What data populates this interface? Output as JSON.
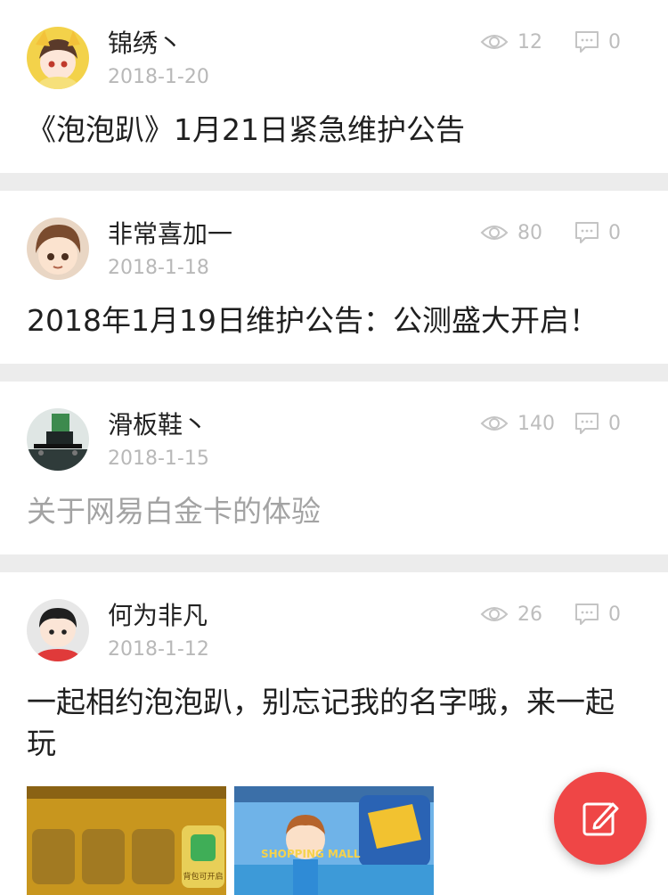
{
  "posts": [
    {
      "author": "锦绣丶",
      "date": "2018-1-20",
      "views": "12",
      "comments": "0",
      "title": "《泡泡趴》1月21日紧急维护公告",
      "read": false
    },
    {
      "author": "非常喜加一",
      "date": "2018-1-18",
      "views": "80",
      "comments": "0",
      "title": "2018年1月19日维护公告：公测盛大开启！",
      "read": false
    },
    {
      "author": "滑板鞋丶",
      "date": "2018-1-15",
      "views": "140",
      "comments": "0",
      "title": "关于网易白金卡的体验",
      "read": true
    },
    {
      "author": "何为非凡",
      "date": "2018-1-12",
      "views": "26",
      "comments": "0",
      "title": "一起相约泡泡趴，别忘记我的名字哦，来一起玩",
      "read": false,
      "images": [
        {
          "icon": "game-screenshot-bag-unlock",
          "text": "背包可开启"
        },
        {
          "icon": "game-screenshot-shopping-mall",
          "text": "SHOPPING MALL"
        }
      ]
    }
  ],
  "icons": {
    "views": "eye-icon",
    "comments": "comment-icon",
    "compose": "edit-icon"
  },
  "colors": {
    "fab": "#ef4646",
    "separator": "#ececec",
    "meta": "#bdbdbd"
  }
}
